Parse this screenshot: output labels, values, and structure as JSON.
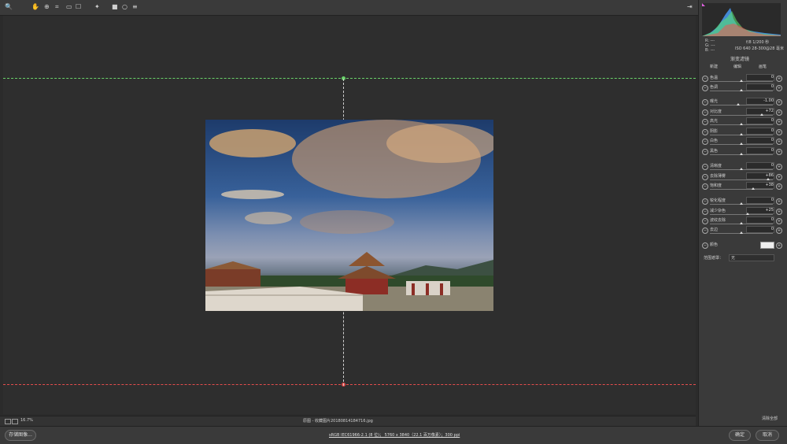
{
  "toolbar": {
    "icons": [
      "zoom-icon",
      "hand-icon",
      "crop-icon",
      "straighten-icon",
      "transform-icon",
      "heal-icon",
      "redeye-icon",
      "brush-icon",
      "radial-icon",
      "settings-icon"
    ],
    "export_icon": "export-icon"
  },
  "canvas": {
    "colors": {
      "guide_top": "#6ad26a",
      "guide_bottom": "#e44c4c",
      "guide_center": "#cfcfcf"
    }
  },
  "panel": {
    "camera_info": {
      "line1": "f/8   1/200 秒",
      "line2": "ISO 640   28-300@28 毫米",
      "r": "R: ---",
      "g": "G: ---",
      "b": "B: ---"
    },
    "section_title": "渐变滤镜",
    "mode_new": "新建",
    "mode_edit": "编辑",
    "mode_brush": "画笔",
    "sliders": [
      {
        "label": "色温",
        "value": "0"
      },
      {
        "label": "色调",
        "value": "0"
      },
      {
        "label": "曝光",
        "value": "-1.00"
      },
      {
        "label": "对比度",
        "value": "+72"
      },
      {
        "label": "高光",
        "value": "0"
      },
      {
        "label": "阴影",
        "value": "0"
      },
      {
        "label": "白色",
        "value": "0"
      },
      {
        "label": "黑色",
        "value": "0"
      },
      {
        "label": "清晰度",
        "value": "0"
      },
      {
        "label": "去除薄雾",
        "value": "+86"
      },
      {
        "label": "饱和度",
        "value": "+38"
      },
      {
        "label": "锐化程度",
        "value": "0"
      },
      {
        "label": "减少杂色",
        "value": "+25"
      },
      {
        "label": "波纹去除",
        "value": "0"
      },
      {
        "label": "去边",
        "value": "0"
      }
    ],
    "color_label": "颜色",
    "range_mask_label": "范围遮罩：",
    "range_mask_value": "无",
    "reset_label": "清除全部"
  },
  "statusbar": {
    "zoom": "16.7%",
    "filename": "原图 -   收藏图片20180814184716.jpg"
  },
  "bottombar": {
    "save_label": "存储图像...",
    "info_link": "sRGB IEC61966-2.1 (8 位)；  5760 x 3840（22.1 百万像素）；300 ppi",
    "ok_label": "确定",
    "cancel_label": "取消"
  }
}
